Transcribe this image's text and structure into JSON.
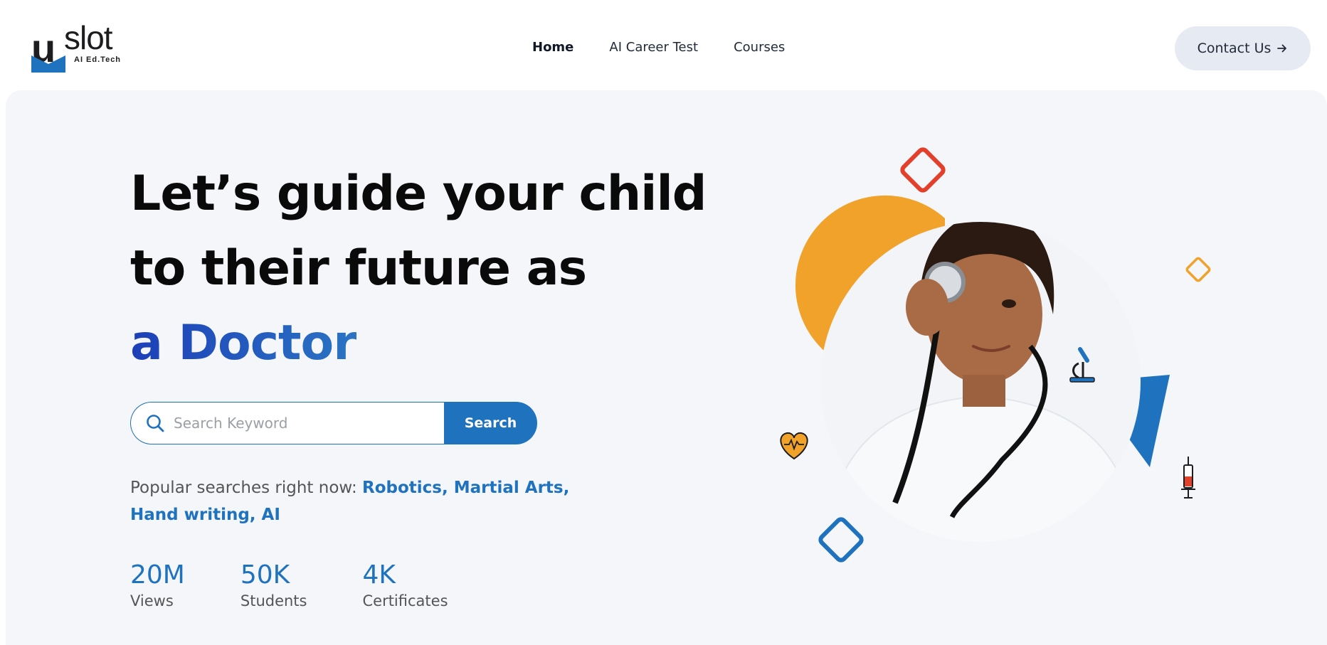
{
  "brand": {
    "logo_letter": "u",
    "logo_word": "slot",
    "tagline": "AI Ed.Tech"
  },
  "nav": {
    "items": [
      {
        "label": "Home",
        "active": true
      },
      {
        "label": "AI Career Test",
        "active": false
      },
      {
        "label": "Courses",
        "active": false
      }
    ],
    "contact_label": "Contact Us",
    "contact_icon": "arrow-right-icon"
  },
  "hero": {
    "headline_line1": "Let’s guide your child",
    "headline_line2": "to their future as",
    "headline_accent": "a Doctor",
    "search": {
      "placeholder": "Search Keyword",
      "button_label": "Search",
      "icon": "search-icon"
    },
    "popular_prefix": "Popular searches right now: ",
    "popular_tags": "Robotics, Martial Arts, Hand writing, AI",
    "stats": [
      {
        "value": "20M",
        "label": "Views"
      },
      {
        "value": "50K",
        "label": "Students"
      },
      {
        "value": "4K",
        "label": "Certificates"
      }
    ]
  },
  "colors": {
    "accent_blue": "#1f72bd",
    "accent_orange": "#f0a22a",
    "accent_red": "#e2402b",
    "hero_bg": "#f4f6fa"
  },
  "illustration": {
    "icons": [
      "heart-pulse-icon",
      "microscope-icon",
      "syringe-icon"
    ],
    "subject": "child-doctor-photo"
  }
}
